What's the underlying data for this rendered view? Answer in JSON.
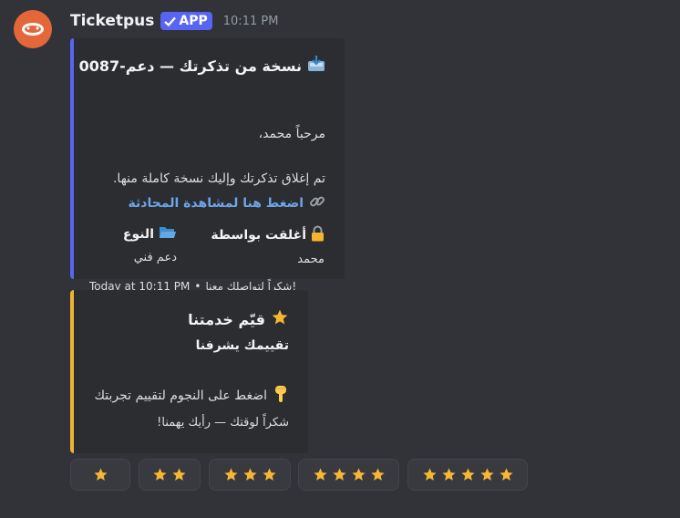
{
  "message": {
    "username": "Ticketpus",
    "badge": "APP",
    "timestamp": "10:11 PM"
  },
  "embed1": {
    "title": "نسخة من تذكرتك — دعم-0087",
    "title_icon": "inbox-tray-icon",
    "greeting": "مرحباً محمد،",
    "desc_line": "تم إغلاق تذكرتك وإليك نسخة كاملة منها.",
    "link_label": "اضغط هنا لمشاهدة المحادثة",
    "link_icon": "link-icon",
    "fields": [
      {
        "name": "أغلقت بواسطة",
        "value": "محمد",
        "icon": "lock-icon"
      },
      {
        "name": "النوع",
        "value": "دعم فني",
        "icon": "open-folder-icon"
      }
    ],
    "footer_time": "Today at 10:11 PM",
    "footer_text": "شكراً لتواصلك معنا!",
    "accent": "#5865f2"
  },
  "embed2": {
    "title": "قيّم خدمتنا",
    "title_icon": "star-icon",
    "subtitle": "تقييمك يشرفنا",
    "line": "اضغط على النجوم لتقييم تجربتك",
    "line_icon": "pointing-down-hand-icon",
    "footer": "شكراً لوقتك — رأيك يهمنا!",
    "accent": "#f0b232"
  },
  "rating_buttons": [
    {
      "stars": 1
    },
    {
      "stars": 2
    },
    {
      "stars": 3
    },
    {
      "stars": 4
    },
    {
      "stars": 5
    }
  ]
}
